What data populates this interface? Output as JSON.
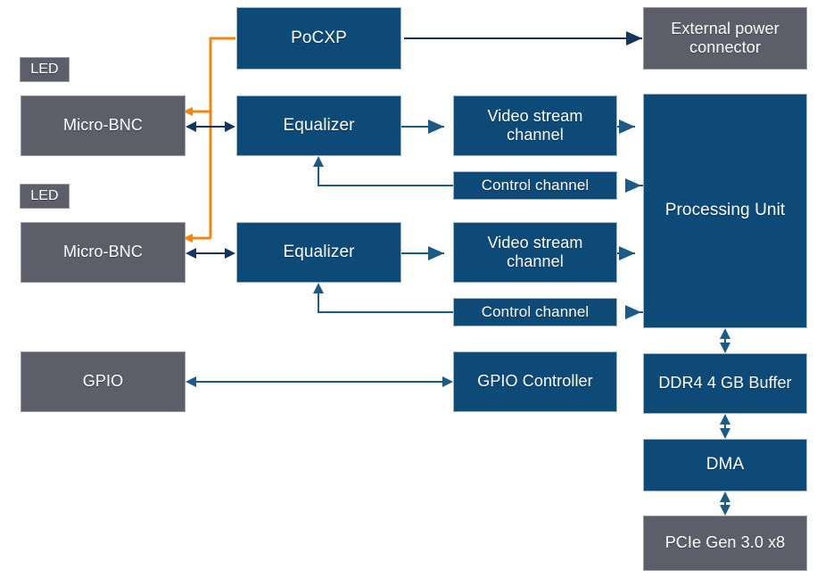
{
  "diagram": {
    "title": "CoaXPress frame grabber block diagram",
    "colors": {
      "blue_block": "#0d4a77",
      "gray_block": "#5e5e6b",
      "wire_blue": "#1d5b87",
      "wire_dark_blue": "#13355e",
      "wire_orange": "#f28411",
      "background": "#ffffff",
      "text": "#ffffff"
    },
    "blocks": {
      "led_1": {
        "label": "LED",
        "kind": "gray"
      },
      "led_2": {
        "label": "LED",
        "kind": "gray"
      },
      "micro_bnc_1": {
        "label": "Micro-BNC",
        "kind": "gray"
      },
      "micro_bnc_2": {
        "label": "Micro-BNC",
        "kind": "gray"
      },
      "gpio": {
        "label": "GPIO",
        "kind": "gray"
      },
      "pocxp": {
        "label": "PoCXP",
        "kind": "blue"
      },
      "equalizer_1": {
        "label": "Equalizer",
        "kind": "blue"
      },
      "equalizer_2": {
        "label": "Equalizer",
        "kind": "blue"
      },
      "video_stream_channel_1": {
        "label": "Video stream channel",
        "kind": "blue"
      },
      "video_stream_channel_2": {
        "label": "Video stream channel",
        "kind": "blue"
      },
      "control_channel_1": {
        "label": "Control channel",
        "kind": "blue"
      },
      "control_channel_2": {
        "label": "Control channel",
        "kind": "blue"
      },
      "gpio_controller": {
        "label": "GPIO Controller",
        "kind": "blue"
      },
      "processing_unit": {
        "label": "Processing Unit",
        "kind": "blue"
      },
      "external_power_connector": {
        "label": "External power connector",
        "kind": "gray"
      },
      "ddr4_buffer": {
        "label": "DDR4 4 GB Buffer",
        "kind": "blue"
      },
      "dma": {
        "label": "DMA",
        "kind": "blue"
      },
      "pcie": {
        "label": "PCIe Gen 3.0 x8",
        "kind": "gray"
      }
    },
    "connections": [
      {
        "name": "external-power-to-pocxp",
        "from": "external_power_connector",
        "to": "pocxp",
        "arrows": "single",
        "color": "#13355e"
      },
      {
        "name": "pocxp-to-micro-bnc-1",
        "from": "pocxp",
        "to": "micro_bnc_1",
        "arrows": "single",
        "color": "#f28411"
      },
      {
        "name": "pocxp-to-micro-bnc-2",
        "from": "pocxp",
        "to": "micro_bnc_2",
        "arrows": "single",
        "color": "#f28411"
      },
      {
        "name": "micro-bnc-1-to-equalizer-1",
        "from": "micro_bnc_1",
        "to": "equalizer_1",
        "arrows": "double",
        "color": "#13355e"
      },
      {
        "name": "micro-bnc-2-to-equalizer-2",
        "from": "micro_bnc_2",
        "to": "equalizer_2",
        "arrows": "double",
        "color": "#13355e"
      },
      {
        "name": "equalizer-1-to-video-stream-1",
        "from": "equalizer_1",
        "to": "video_stream_channel_1",
        "arrows": "single",
        "color": "#1d5b87"
      },
      {
        "name": "equalizer-2-to-video-stream-2",
        "from": "equalizer_2",
        "to": "video_stream_channel_2",
        "arrows": "single",
        "color": "#1d5b87"
      },
      {
        "name": "video-stream-1-to-processing-unit",
        "from": "video_stream_channel_1",
        "to": "processing_unit",
        "arrows": "single",
        "color": "#1d5b87"
      },
      {
        "name": "video-stream-2-to-processing-unit",
        "from": "video_stream_channel_2",
        "to": "processing_unit",
        "arrows": "single",
        "color": "#1d5b87"
      },
      {
        "name": "processing-unit-to-control-channel-1",
        "from": "processing_unit",
        "to": "control_channel_1",
        "arrows": "single",
        "color": "#1d5b87"
      },
      {
        "name": "processing-unit-to-control-channel-2",
        "from": "processing_unit",
        "to": "control_channel_2",
        "arrows": "single",
        "color": "#1d5b87"
      },
      {
        "name": "control-channel-1-to-equalizer-1",
        "from": "control_channel_1",
        "to": "equalizer_1",
        "arrows": "single",
        "color": "#1d5b87"
      },
      {
        "name": "control-channel-2-to-equalizer-2",
        "from": "control_channel_2",
        "to": "equalizer_2",
        "arrows": "single",
        "color": "#1d5b87"
      },
      {
        "name": "gpio-to-gpio-controller",
        "from": "gpio",
        "to": "gpio_controller",
        "arrows": "double",
        "color": "#1d5b87"
      },
      {
        "name": "gpio-controller-to-processing-unit",
        "from": "gpio_controller",
        "to": "processing_unit",
        "arrows": "single",
        "color": "#1d5b87"
      },
      {
        "name": "processing-unit-to-ddr4",
        "from": "processing_unit",
        "to": "ddr4_buffer",
        "arrows": "double",
        "color": "#1d5b87"
      },
      {
        "name": "ddr4-to-dma",
        "from": "ddr4_buffer",
        "to": "dma",
        "arrows": "double",
        "color": "#1d5b87"
      },
      {
        "name": "dma-to-pcie",
        "from": "dma",
        "to": "pcie",
        "arrows": "double",
        "color": "#1d5b87"
      }
    ]
  }
}
